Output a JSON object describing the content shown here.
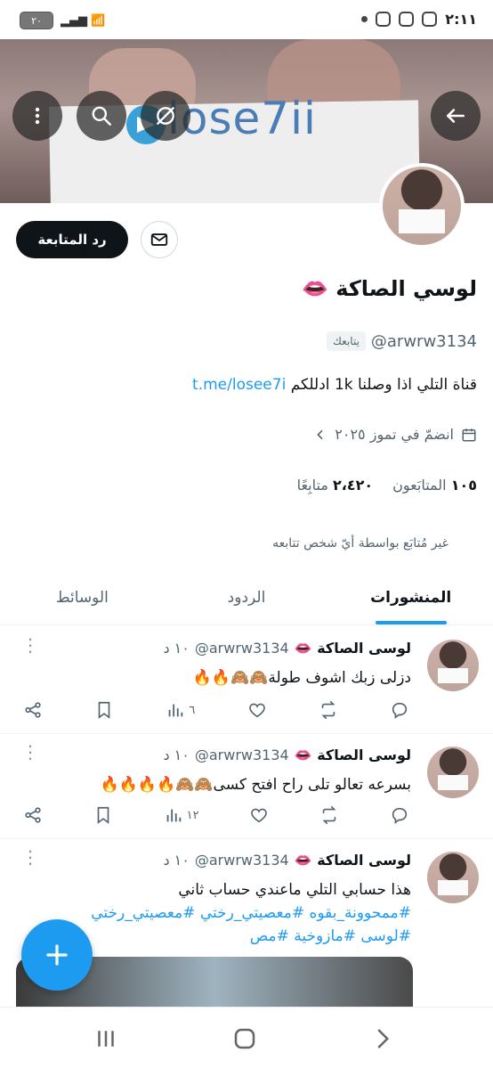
{
  "status_bar": {
    "time": "٢:١١",
    "battery": "٢٠",
    "signal": "5"
  },
  "header": {
    "banner_text": "lose7ii",
    "back_icon": "arrow-left-icon",
    "grok_icon": "slash-circle-icon",
    "search_icon": "search-icon",
    "more_icon": "more-vertical-icon"
  },
  "profile": {
    "display_name": "لوسي الصاكة 👄",
    "handle": "@arwrw3134",
    "follows_you": "يتابعك",
    "bio_text": "قناة التلي اذا وصلنا 1k ادللكم",
    "bio_link": "t.me/losee7i",
    "joined": "انضمّ في تموز ٢٠٢٥",
    "followers_count": "١٠٥",
    "followers_label": "المتابَعون",
    "following_count": "٢،٤٢٠",
    "following_label": "متابِعًا",
    "not_followed": "غير مُتابَع بواسطة أيّ شخص تتابعه",
    "follow_back_label": "رد المتابعة"
  },
  "tabs": [
    "المنشورات",
    "الردود",
    "الوسائط"
  ],
  "tweets": [
    {
      "name": "لوسى الصاكة 👄",
      "handle": "@arwrw3134",
      "time": "١٠ د",
      "text": "دزلى زبك اشوف طولة🙈🙈🔥🔥",
      "views": "٦"
    },
    {
      "name": "لوسى الصاكة 👄",
      "handle": "@arwrw3134",
      "time": "١٠ د",
      "text": "بسرعه تعالو تلى راح افتح كسى🙈🙈🔥🔥🔥🔥",
      "views": "١٢"
    },
    {
      "name": "لوسى الصاكة 👄",
      "handle": "@arwrw3134",
      "time": "١٠ د",
      "text": "هذا حسابي التلي ماعندي حساب ثاني",
      "tags_line1": "#ممحوونة_بقوه #معصيتي_رختي #معصيتي_رختي",
      "tags_line2": "#لوسى #مازوخية #مص"
    }
  ],
  "colors": {
    "accent": "#1d9bf0",
    "text": "#0f1419",
    "muted": "#536471"
  }
}
